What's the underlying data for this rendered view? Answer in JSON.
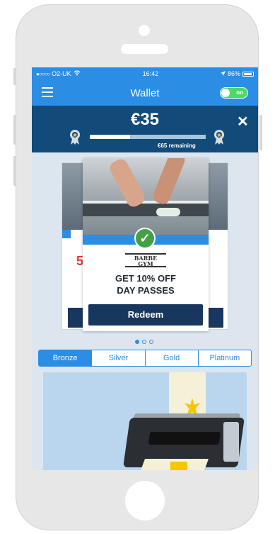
{
  "status": {
    "carrier": "O2-UK",
    "time": "16:42",
    "battery": "86%"
  },
  "nav": {
    "title": "Wallet",
    "toggle_label": "on"
  },
  "balance": {
    "amount": "€35",
    "remaining": "€65 remaining",
    "progress": 0.35
  },
  "card": {
    "logo_line1": "BARBE",
    "logo_line2": "GYM",
    "offer_line1": "GET 10% OFF",
    "offer_line2": "DAY PASSES",
    "redeem_label": "Redeem"
  },
  "carousel": {
    "pages": 3,
    "active_page": 0
  },
  "tiers": [
    "Bronze",
    "Silver",
    "Gold",
    "Platinum"
  ],
  "active_tier": "Bronze",
  "colors": {
    "brand_blue": "#2b8de3",
    "navy": "#124a7a",
    "button_navy": "#17375e",
    "success_green": "#43a047"
  },
  "icons": [
    "menu-icon",
    "wifi-icon",
    "location-arrow-icon",
    "battery-icon",
    "close-icon",
    "medal-icon",
    "checkmark-icon"
  ]
}
